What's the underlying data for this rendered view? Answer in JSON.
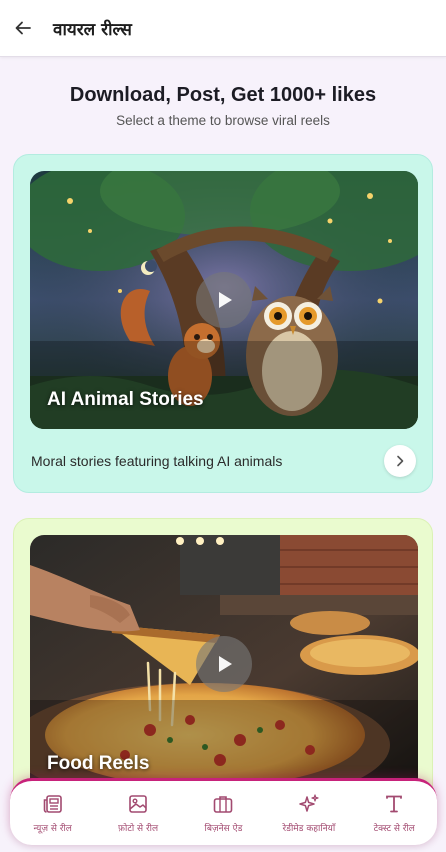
{
  "appbar": {
    "title": "वायरल रील्स",
    "back_icon": "arrow-left-icon"
  },
  "header": {
    "headline": "Download, Post, Get 1000+ likes",
    "subheadline": "Select a theme to browse viral reels"
  },
  "themes": [
    {
      "title": "AI Animal Stories",
      "description": "Moral stories featuring talking AI animals",
      "card_color": "#c9f7ea"
    },
    {
      "title": "Food Reels",
      "description": "",
      "card_color": "#eafbcf"
    }
  ],
  "bottom_nav": {
    "accent_color": "#c7227a",
    "items": [
      {
        "label": "न्यूज़ से रील",
        "icon": "newspaper-icon"
      },
      {
        "label": "फ़ोटो से रील",
        "icon": "image-icon"
      },
      {
        "label": "बिज़नेस ऐड",
        "icon": "briefcase-icon"
      },
      {
        "label": "रेडीमेड कहानियाँ",
        "icon": "sparkles-icon"
      },
      {
        "label": "टेक्स्ट से रील",
        "icon": "text-t-icon"
      }
    ]
  }
}
